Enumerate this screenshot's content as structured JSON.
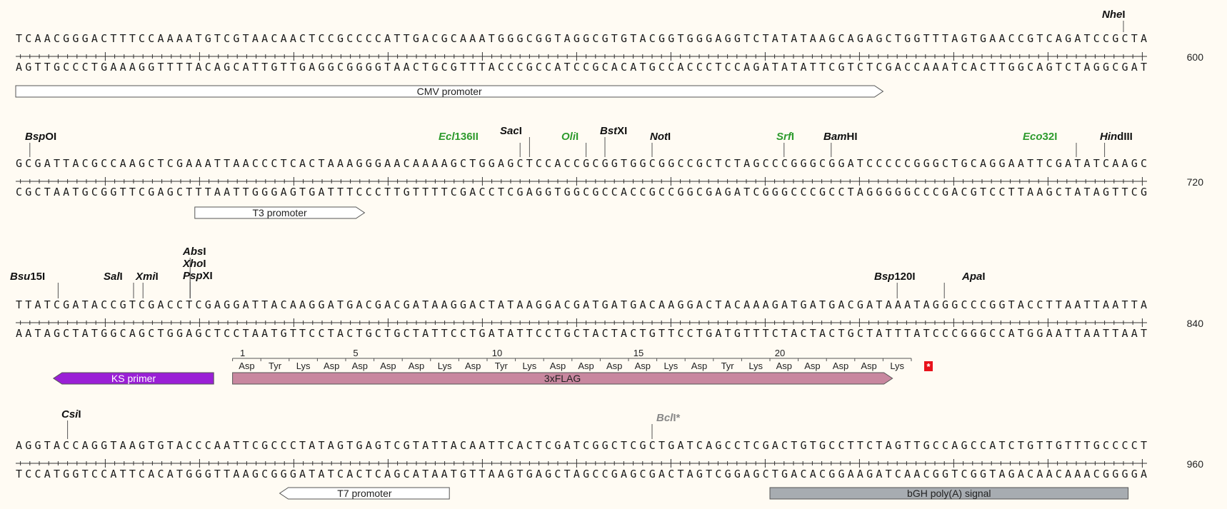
{
  "rows": [
    {
      "top": "TCAACGGGACTTTCCAAAATGTCGTAACAACTCCGCCCCATTGACGCAAATGGGCGGTAGGCGTGTACGGTGGGAGGTCTATATAAGCAGAGCTGGTTTAGTGAACCGTCAGATCCGCTA",
      "bottom": "AGTTGCCCTGAAAGGTTTTACAGCATTGTTGAGGCGGGGTAACTGCGTTTACCCGCCATCCGCACATGCCACCCTCCAGATATATTCGTCTCGACCAAATCACTTGGCAGTCTAGGCGAT",
      "end": "600"
    },
    {
      "top": "GCGATTACGCCAAGCTCGAAATTAACCCTCACTAAAGGGAACAAAAGCTGGAGCTCCACCGCGGTGGCGGCCGCTCTAGCCCGGGCGGATCCCCCGGGCTGCAGGAATTCGATATCAAGC",
      "bottom": "CGCTAATGCGGTTCGAGCTTTAATTGGGAGTGATTTCCCTTGTTTTCGACCTCGAGGTGGCGCCACCGCCGGCGAGATCGGGCCCGCCTAGGGGGCCCGACGTCCTTAAGCTATAGTTCG",
      "end": "720"
    },
    {
      "top": "TTATCGATACCGTCGACCTCGAGGATTACAAGGATGACGACGATAAGGACTATAAGGACGATGATGACAAGGACTACAAAGATGATGACGATAAATAGGGCCCGGTACCTTAATTAATTA",
      "bottom": "AATAGCTATGGCAGCTGGAGCTCCTAATGTTCCTACTGCTGCTATTCCTGATATTCCTGCTACTACTGTTCCTGATGTTTCTACTACTGCTATTTATCCCGGGCCATGGAATTAATTAAT",
      "end": "840"
    },
    {
      "top": "AGGTACCAGGTAAGTGTACCCAATTCGCCCTATAGTGAGTCGTATTACAATTCACTCGATCGGCTCGCTGATCAGCCTCGACTGTGCCTTCTAGTTGCCAGCCATCTGTTGTTTGCCCCT",
      "bottom": "TCCATGGTCCATTCACATGGGTTAAGCGGGATATCACTCAGCATAATGTTAAGTGAGCTAGCCGAGCGACTAGTCGGAGCTGACACGGAAGATCAACGGTCGGTAGACAACAAACGGGGA",
      "end": "960"
    }
  ],
  "enzymes": [
    {
      "row": 0,
      "pos": 117,
      "italic": "Nhe",
      "rest": "I",
      "color": "#111111"
    },
    {
      "row": 1,
      "pos": 1,
      "italic": "Bsp",
      "rest": "OI",
      "color": "#111111"
    },
    {
      "row": 1,
      "pos": 53,
      "italic": "Ecl",
      "rest": "136II",
      "color": "#2e9b2e"
    },
    {
      "row": 1,
      "pos": 54,
      "italic": "Sac",
      "rest": "I",
      "color": "#111111"
    },
    {
      "row": 1,
      "pos": 60,
      "italic": "Oli",
      "rest": "I",
      "color": "#2e9b2e"
    },
    {
      "row": 1,
      "pos": 62,
      "italic": "Bst",
      "rest": "XI",
      "color": "#111111"
    },
    {
      "row": 1,
      "pos": 67,
      "italic": "Not",
      "rest": "I",
      "color": "#111111"
    },
    {
      "row": 1,
      "pos": 81,
      "italic": "Srf",
      "rest": "I",
      "color": "#2e9b2e"
    },
    {
      "row": 1,
      "pos": 86,
      "italic": "Bam",
      "rest": "HI",
      "color": "#111111"
    },
    {
      "row": 1,
      "pos": 112,
      "italic": "Eco",
      "rest": "32I",
      "color": "#2e9b2e"
    },
    {
      "row": 1,
      "pos": 115,
      "italic": "Hin",
      "rest": "dIII",
      "color": "#111111"
    },
    {
      "row": 2,
      "pos": 4,
      "italic": "Bsu",
      "rest": "15I",
      "color": "#111111"
    },
    {
      "row": 2,
      "pos": 12,
      "italic": "Sal",
      "rest": "I",
      "color": "#111111"
    },
    {
      "row": 2,
      "pos": 13,
      "italic": "Xmi",
      "rest": "I",
      "color": "#111111"
    },
    {
      "row": 2,
      "pos": 18,
      "italic": "Abs",
      "rest": "I",
      "color": "#111111"
    },
    {
      "row": 2,
      "pos": 18,
      "italic": "Xho",
      "rest": "I",
      "color": "#111111"
    },
    {
      "row": 2,
      "pos": 18,
      "italic": "Psp",
      "rest": "XI",
      "color": "#111111"
    },
    {
      "row": 2,
      "pos": 93,
      "italic": "Bsp",
      "rest": "120I",
      "color": "#111111"
    },
    {
      "row": 2,
      "pos": 98,
      "italic": "Apa",
      "rest": "I",
      "color": "#111111"
    },
    {
      "row": 3,
      "pos": 5,
      "italic": "Csi",
      "rest": "I",
      "color": "#111111"
    },
    {
      "row": 3,
      "pos": 67,
      "italic": "Bcl",
      "rest": "I*",
      "color": "#888888"
    }
  ],
  "features": [
    {
      "row": 0,
      "label": "CMV promoter",
      "start": 0,
      "end": 92,
      "dir": "right",
      "fill": "#ffffff",
      "text": "#222222"
    },
    {
      "row": 1,
      "label": "T3 promoter",
      "start": 19,
      "end": 37,
      "dir": "right",
      "fill": "#ffffff",
      "text": "#222222"
    },
    {
      "row": 2,
      "label": "KS primer",
      "start": 4,
      "end": 21,
      "dir": "left",
      "fill": "#9a1fd6",
      "text": "#ffffff"
    },
    {
      "row": 2,
      "label": "3xFLAG",
      "start": 23,
      "end": 93,
      "dir": "right",
      "fill": "#c8879f",
      "text": "#222222"
    },
    {
      "row": 3,
      "label": "T7 promoter",
      "start": 28,
      "end": 46,
      "dir": "left",
      "fill": "#ffffff",
      "text": "#222222"
    },
    {
      "row": 3,
      "label": "bGH poly(A) signal",
      "start": 80,
      "end": 118,
      "dir": "none",
      "fill": "#a7acb1",
      "text": "#222222"
    }
  ],
  "translation": {
    "row": 2,
    "start": 23,
    "residues": [
      "Asp",
      "Tyr",
      "Lys",
      "Asp",
      "Asp",
      "Asp",
      "Asp",
      "Lys",
      "Asp",
      "Tyr",
      "Lys",
      "Asp",
      "Asp",
      "Asp",
      "Asp",
      "Lys",
      "Asp",
      "Tyr",
      "Lys",
      "Asp",
      "Asp",
      "Asp",
      "Asp",
      "Lys"
    ],
    "numbers": [
      "1",
      "5",
      "10",
      "15",
      "20"
    ],
    "stop": "*"
  }
}
